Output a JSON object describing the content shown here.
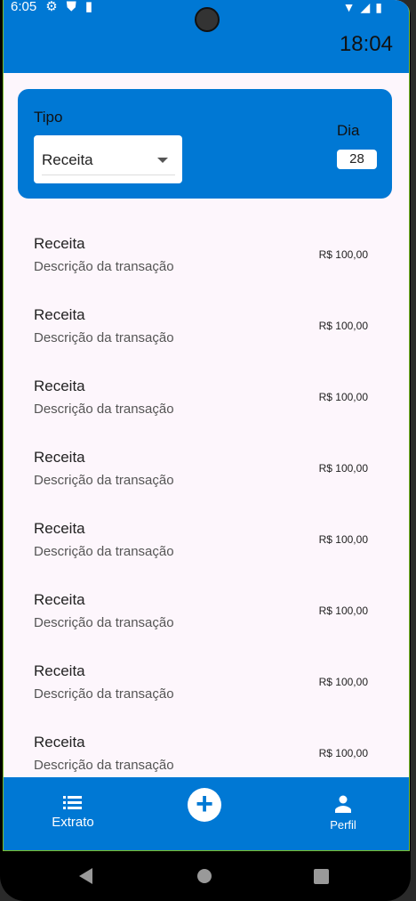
{
  "status": {
    "time": "6:05"
  },
  "appbar": {
    "clock": "18:04"
  },
  "filter": {
    "tipo_label": "Tipo",
    "tipo_value": "Receita",
    "dia_label": "Dia",
    "dia_value": "28"
  },
  "transactions": [
    {
      "title": "Receita",
      "description": "Descrição da transação",
      "value": "R$ 100,00"
    },
    {
      "title": "Receita",
      "description": "Descrição da transação",
      "value": "R$ 100,00"
    },
    {
      "title": "Receita",
      "description": "Descrição da transação",
      "value": "R$ 100,00"
    },
    {
      "title": "Receita",
      "description": "Descrição da transação",
      "value": "R$ 100,00"
    },
    {
      "title": "Receita",
      "description": "Descrição da transação",
      "value": "R$ 100,00"
    },
    {
      "title": "Receita",
      "description": "Descrição da transação",
      "value": "R$ 100,00"
    },
    {
      "title": "Receita",
      "description": "Descrição da transação",
      "value": "R$ 100,00"
    },
    {
      "title": "Receita",
      "description": "Descrição da transação",
      "value": "R$ 100,00"
    }
  ],
  "bottom_nav": {
    "extrato": "Extrato",
    "add": "+",
    "perfil": "Perfil"
  },
  "colors": {
    "primary": "#0078d4",
    "background": "#fdf6fc"
  }
}
